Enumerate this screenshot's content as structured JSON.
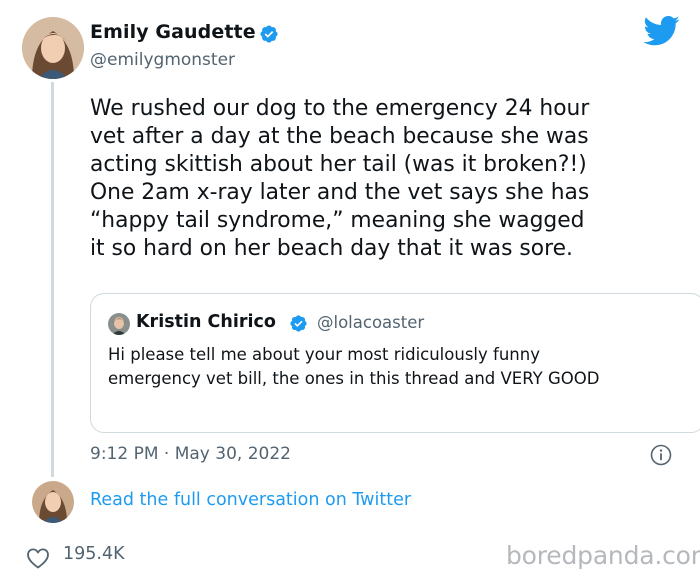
{
  "tweet": {
    "author": {
      "name": "Emily Gaudette",
      "handle": "@emilygmonster",
      "verified": true
    },
    "text": "We rushed our dog to the emergency 24 hour\nvet after a day at the beach because she was\nacting skittish about her tail (was it broken?!)\nOne 2am x-ray later and the vet says she has\n“happy tail syndrome,” meaning she wagged\nit so hard on her beach day that it was sore.",
    "timestamp": "9:12 PM · May 30, 2022"
  },
  "quote": {
    "author": {
      "name": "Kristin Chirico",
      "handle": "@lolacoaster",
      "verified": true
    },
    "text": "Hi please tell me about your most ridiculously funny emergency vet bill, the ones in this thread and VERY GOOD"
  },
  "conversation_link": "Read the full conversation on Twitter",
  "likes": "195.4K",
  "watermark": "boredpanda.com",
  "icons": {
    "brand": "twitter-bird-icon",
    "verified": "verified-badge-icon",
    "info": "info-icon",
    "like": "heart-icon"
  },
  "colors": {
    "accent": "#1d9bf0",
    "text": "#0f1419",
    "secondary": "#536471",
    "border": "#cfd9de",
    "watermark": "#b5b8bc"
  }
}
